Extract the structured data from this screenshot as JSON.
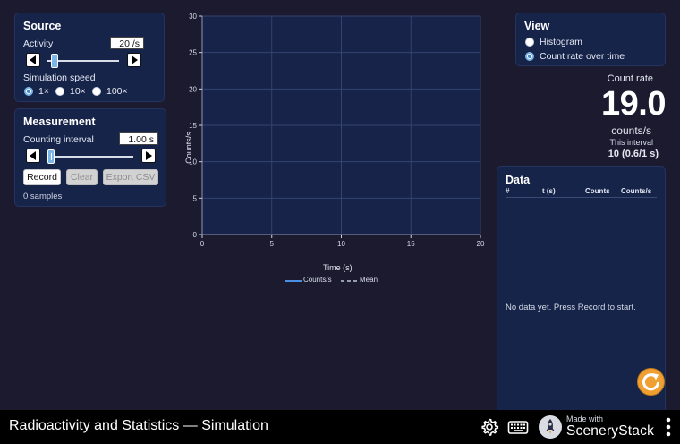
{
  "source": {
    "title": "Source",
    "activity_label": "Activity",
    "activity_value": "20 /s",
    "activity_slider_fraction": 0.06,
    "speed_label": "Simulation speed",
    "speed_options": [
      "1×",
      "10×",
      "100×"
    ],
    "speed_selected": "1×"
  },
  "measurement": {
    "title": "Measurement",
    "interval_label": "Counting interval",
    "interval_value": "1.00 s",
    "interval_slider_fraction": 0.0,
    "record_label": "Record",
    "clear_label": "Clear",
    "export_label": "Export CSV",
    "samples_text": "0 samples"
  },
  "view": {
    "title": "View",
    "options": [
      "Histogram",
      "Count rate over time"
    ],
    "selected": "Count rate over time"
  },
  "count_rate": {
    "label": "Count rate",
    "value": "19.0",
    "unit": "counts/s",
    "interval_label": "This interval",
    "interval_value": "10 (0.6/1 s)"
  },
  "data_table": {
    "title": "Data",
    "columns": [
      "#",
      "t (s)",
      "Counts",
      "Counts/s"
    ],
    "rows": [],
    "empty_message": "No data yet. Press Record to start."
  },
  "chart_data": {
    "type": "line",
    "title": "",
    "xlabel": "Time (s)",
    "ylabel": "Counts/s",
    "xlim": [
      0,
      20
    ],
    "ylim": [
      0,
      30
    ],
    "xticks": [
      0,
      5,
      10,
      15,
      20
    ],
    "yticks": [
      0,
      5,
      10,
      15,
      20,
      25,
      30
    ],
    "grid": true,
    "legend_position": "bottom",
    "series": [
      {
        "name": "Counts/s",
        "style": "solid",
        "color": "#4a90e2",
        "x": [],
        "y": []
      },
      {
        "name": "Mean",
        "style": "dashed",
        "color": "#bfc6d6",
        "x": [],
        "y": []
      }
    ]
  },
  "footer": {
    "title": "Radioactivity and Statistics — Simulation",
    "made_with": "Made with",
    "brand": "SceneryStack"
  },
  "colors": {
    "background": "#1b1a2e",
    "panel": "#17244a",
    "accent": "#7ab7e8",
    "reset": "#f0a030"
  },
  "icons": [
    "left-arrow-icon",
    "right-arrow-icon",
    "gear-icon",
    "keyboard-icon",
    "rocket-icon",
    "kebab-menu-icon",
    "reset-icon"
  ]
}
